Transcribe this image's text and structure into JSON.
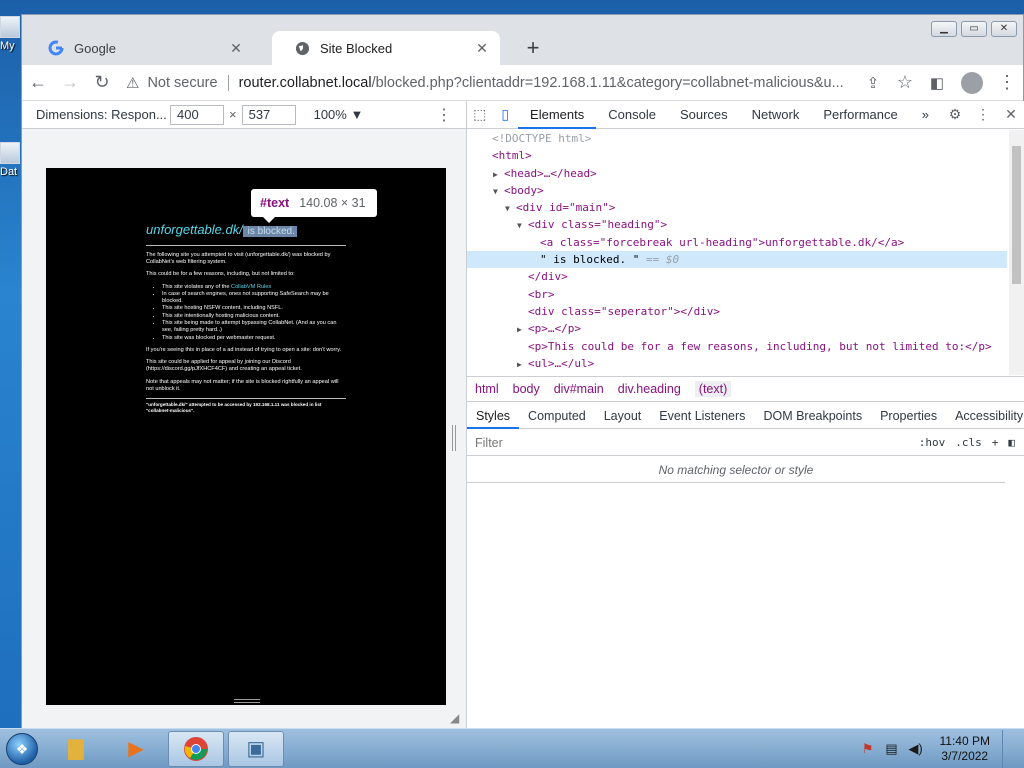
{
  "desktop": {
    "icons": [
      {
        "label": "My"
      },
      {
        "label": "Dat"
      }
    ]
  },
  "browser": {
    "tabs": [
      {
        "label": "Google",
        "favicon": "google-icon",
        "active": false
      },
      {
        "label": "Site Blocked",
        "favicon": "globe-icon",
        "active": true
      }
    ],
    "new_tab": "+",
    "address": {
      "security": "Not secure",
      "host": "router.collabnet.local",
      "path": "/blocked.php?clientaddr=192.168.1.11&category=collabnet-malicious&u..."
    }
  },
  "device_toolbar": {
    "dimensions": "Dimensions: Respon... ▼",
    "width": "400",
    "height": "537",
    "times": "×",
    "zoom": "100% ▼"
  },
  "blocked_page": {
    "domain": "unforgettable.dk/",
    "suffix": " is blocked.",
    "p1": "The following site you attempted to visit (unforgettable.dk/) was blocked by CollabNet's web filtering system.",
    "p2": "This could be for a few reasons, including, but not limited to:",
    "reasons": [
      "This site violates any of the ",
      "In case of search engines, ones not supporting SafeSearch may be blocked.",
      "This site hosting NSFW content, including NSFL.",
      "This site intentionally hosting malicious content.",
      "This site being made to attempt bypassing CollabNet. (And as you can see, failing pretty hard..)",
      "This site was blocked per webmaster request."
    ],
    "rules_link": "CollabVM Rules",
    "p3": "If you're seeing this in place of a ad instead of trying to open a site: don't worry.",
    "p4": "This site could be applied for appeal by joining our Discord (https://discord.gg/pJfXHCF4CF) and creating an appeal ticket.",
    "p5": "Note that appeals may not matter; if the site is blocked rightfully an appeal will not unblock it.",
    "footer": "\"unforgettable.dk/\" attempted to be accessed by 192.168.1.11 was blocked in list \"collabnet-malicious\"."
  },
  "tooltip": {
    "node": "#text",
    "size": "140.08 × 31"
  },
  "devtools": {
    "tabs": [
      "Elements",
      "Console",
      "Sources",
      "Network",
      "Performance"
    ],
    "active_tab": "Elements",
    "overflow": "»",
    "dom_lines": [
      {
        "indent": 0,
        "html": "<!DOCTYPE html>",
        "kind": "cmt"
      },
      {
        "indent": 0,
        "html": "<html>",
        "kind": "tag"
      },
      {
        "indent": 1,
        "html": "<head>…</head>",
        "kind": "tag",
        "arrow": "▶"
      },
      {
        "indent": 1,
        "html": "<body>",
        "kind": "tag",
        "arrow": "▼"
      },
      {
        "indent": 2,
        "html": "<div id=\"main\">",
        "kind": "tag",
        "arrow": "▼"
      },
      {
        "indent": 3,
        "html": "<div class=\"heading\">",
        "kind": "tag",
        "arrow": "▼"
      },
      {
        "indent": 4,
        "html": "<a class=\"forcebreak url-heading\">unforgettable.dk/</a>",
        "kind": "tag"
      },
      {
        "indent": 4,
        "html": "\" is blocked. \"",
        "suffix": " == $0",
        "kind": "text",
        "selected": true
      },
      {
        "indent": 3,
        "html": "</div>",
        "kind": "tag"
      },
      {
        "indent": 3,
        "html": "<br>",
        "kind": "tag"
      },
      {
        "indent": 3,
        "html": "<div class=\"seperator\"></div>",
        "kind": "tag"
      },
      {
        "indent": 3,
        "html": "<p>…</p>",
        "kind": "tag",
        "arrow": "▶"
      },
      {
        "indent": 3,
        "html": "<p>This could be for a few reasons, including, but not limited to:</p>",
        "kind": "tag"
      },
      {
        "indent": 3,
        "html": "<ul>…</ul>",
        "kind": "tag",
        "arrow": "▶"
      }
    ],
    "breadcrumbs": [
      "html",
      "body",
      "div#main",
      "div.heading",
      "(text)"
    ],
    "sub_tabs": [
      "Styles",
      "Computed",
      "Layout",
      "Event Listeners",
      "DOM Breakpoints",
      "Properties",
      "Accessibility"
    ],
    "active_sub_tab": "Styles",
    "filter_placeholder": "Filter",
    "filter_tools": [
      ":hov",
      ".cls",
      "+"
    ],
    "no_match": "No matching selector or style"
  },
  "taskbar": {
    "apps": [
      {
        "name": "explorer",
        "active": false
      },
      {
        "name": "media-player",
        "active": false
      },
      {
        "name": "chrome",
        "active": true
      },
      {
        "name": "window",
        "active": true
      }
    ],
    "time": "11:40 PM",
    "date": "3/7/2022"
  }
}
